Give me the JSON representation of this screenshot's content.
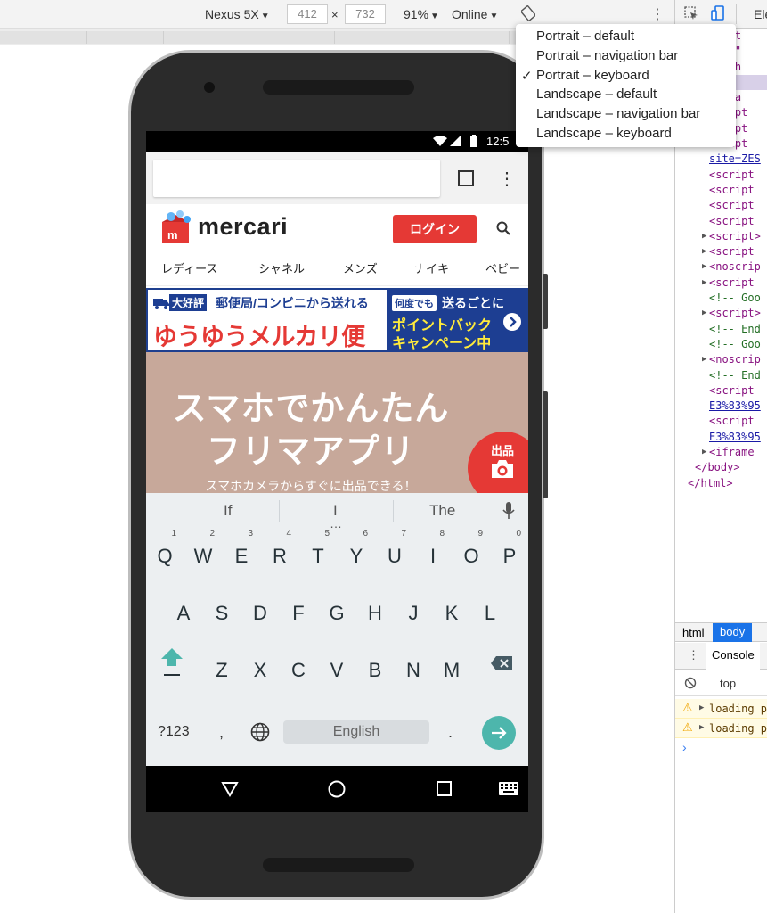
{
  "toolbar": {
    "device": "Nexus 5X",
    "width": "412",
    "times": "×",
    "height": "732",
    "zoom": "91%",
    "network": "Online"
  },
  "orientation_menu": {
    "items": [
      "Portrait – default",
      "Portrait – navigation bar",
      "Portrait – keyboard",
      "Landscape – default",
      "Landscape – navigation bar",
      "Landscape – keyboard"
    ],
    "checkmark": "✓"
  },
  "devtools": {
    "tab_partial": "Ele",
    "elements_lines": [
      {
        "text": "PE ht",
        "cls": ""
      },
      {
        "text": "ang=\"",
        "cls": ""
      },
      {
        "text": ">…</h",
        "cls": ""
      },
      {
        "text": "clas",
        "cls": ""
      },
      {
        "text": "y cla",
        "cls": ""
      },
      {
        "text": "script",
        "cls": ""
      },
      {
        "text": "script",
        "cls": ""
      },
      {
        "text": "script",
        "cls": ""
      },
      {
        "text": "site=ZES",
        "cls": "link"
      },
      {
        "text": "<script",
        "cls": ""
      },
      {
        "text": "<script",
        "cls": ""
      },
      {
        "text": "<script",
        "cls": ""
      },
      {
        "text": "<script",
        "cls": ""
      },
      {
        "text": "<script>",
        "cls": "arrow"
      },
      {
        "text": "<script",
        "cls": "arrow"
      },
      {
        "text": "<noscrip",
        "cls": "arrow"
      },
      {
        "text": "<script",
        "cls": "arrow"
      },
      {
        "text": "<!-- Goo",
        "cls": "comment"
      },
      {
        "text": "<script>",
        "cls": "arrow"
      },
      {
        "text": "<!-- End",
        "cls": "comment"
      },
      {
        "text": "<!-- Goo",
        "cls": "comment"
      },
      {
        "text": "<noscrip",
        "cls": "arrow"
      },
      {
        "text": "<!-- End",
        "cls": "comment"
      },
      {
        "text": "<script",
        "cls": ""
      },
      {
        "text": "E3%83%95",
        "cls": "link"
      },
      {
        "text": "<script",
        "cls": ""
      },
      {
        "text": "E3%83%95",
        "cls": "link"
      },
      {
        "text": "<iframe",
        "cls": "arrow"
      },
      {
        "text": "</body>",
        "cls": "closing"
      },
      {
        "text": "</html>",
        "cls": "closing2"
      }
    ],
    "breadcrumb": [
      "html",
      "body"
    ],
    "console_tab": "Console",
    "context": "top",
    "messages": [
      "loading p",
      "loading p"
    ],
    "prompt": "›"
  },
  "phone": {
    "time": "12:5",
    "header": {
      "brand": "mercari",
      "login": "ログイン"
    },
    "categories": [
      "レディース",
      "シャネル",
      "メンズ",
      "ナイキ",
      "ベビー"
    ],
    "banner": {
      "badge": "大好評",
      "line1": "郵便局/コンビニから送れる",
      "title": "ゆうゆうメルカリ便",
      "tag": "何度でも",
      "line2": "送るごとに",
      "promo1": "ポイントバック",
      "promo2": "キャンペーン中"
    },
    "hero": {
      "line1": "スマホでかんたん",
      "line2": "フリマアプリ",
      "sub": "スマホカメラからすぐに出品できる！",
      "sell": "出品"
    },
    "keyboard": {
      "suggestions": [
        "If",
        "I",
        "The"
      ],
      "row1": [
        "Q",
        "W",
        "E",
        "R",
        "T",
        "Y",
        "U",
        "I",
        "O",
        "P"
      ],
      "row1_nums": [
        "1",
        "2",
        "3",
        "4",
        "5",
        "6",
        "7",
        "8",
        "9",
        "0"
      ],
      "row2": [
        "A",
        "S",
        "D",
        "F",
        "G",
        "H",
        "J",
        "K",
        "L"
      ],
      "row3": [
        "Z",
        "X",
        "C",
        "V",
        "B",
        "N",
        "M"
      ],
      "symbols": "?123",
      "comma": ",",
      "space": "English",
      "period": "."
    }
  },
  "colors": {
    "accent_red": "#e53935",
    "banner_blue": "#1d3e92",
    "enter_teal": "#4db6ac",
    "devtools_blue": "#367cf1"
  }
}
